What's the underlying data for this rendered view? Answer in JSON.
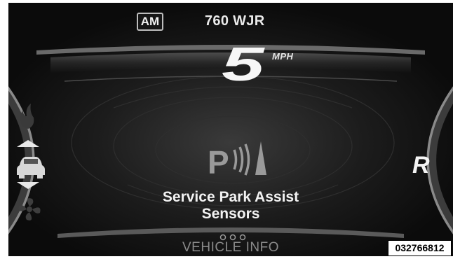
{
  "radio": {
    "band": "AM",
    "station": "760 WJR"
  },
  "speed": {
    "value": "5",
    "unit": "MPH"
  },
  "message": {
    "line1": "Service Park Assist",
    "line2": "Sensors"
  },
  "menu": {
    "title": "VEHICLE INFO"
  },
  "gear": "R",
  "reference_code": "032766812",
  "icons": {
    "left_gauge": [
      "flame-icon",
      "arrow-up-icon",
      "car-icon",
      "arrow-down-icon",
      "fan-icon"
    ],
    "center": "park-assist-icon",
    "menu_dots": "three-dots-icon"
  },
  "colors": {
    "background": "#0b0b0b",
    "text": "#eaeaea",
    "dim_text": "#8a8a8a"
  }
}
